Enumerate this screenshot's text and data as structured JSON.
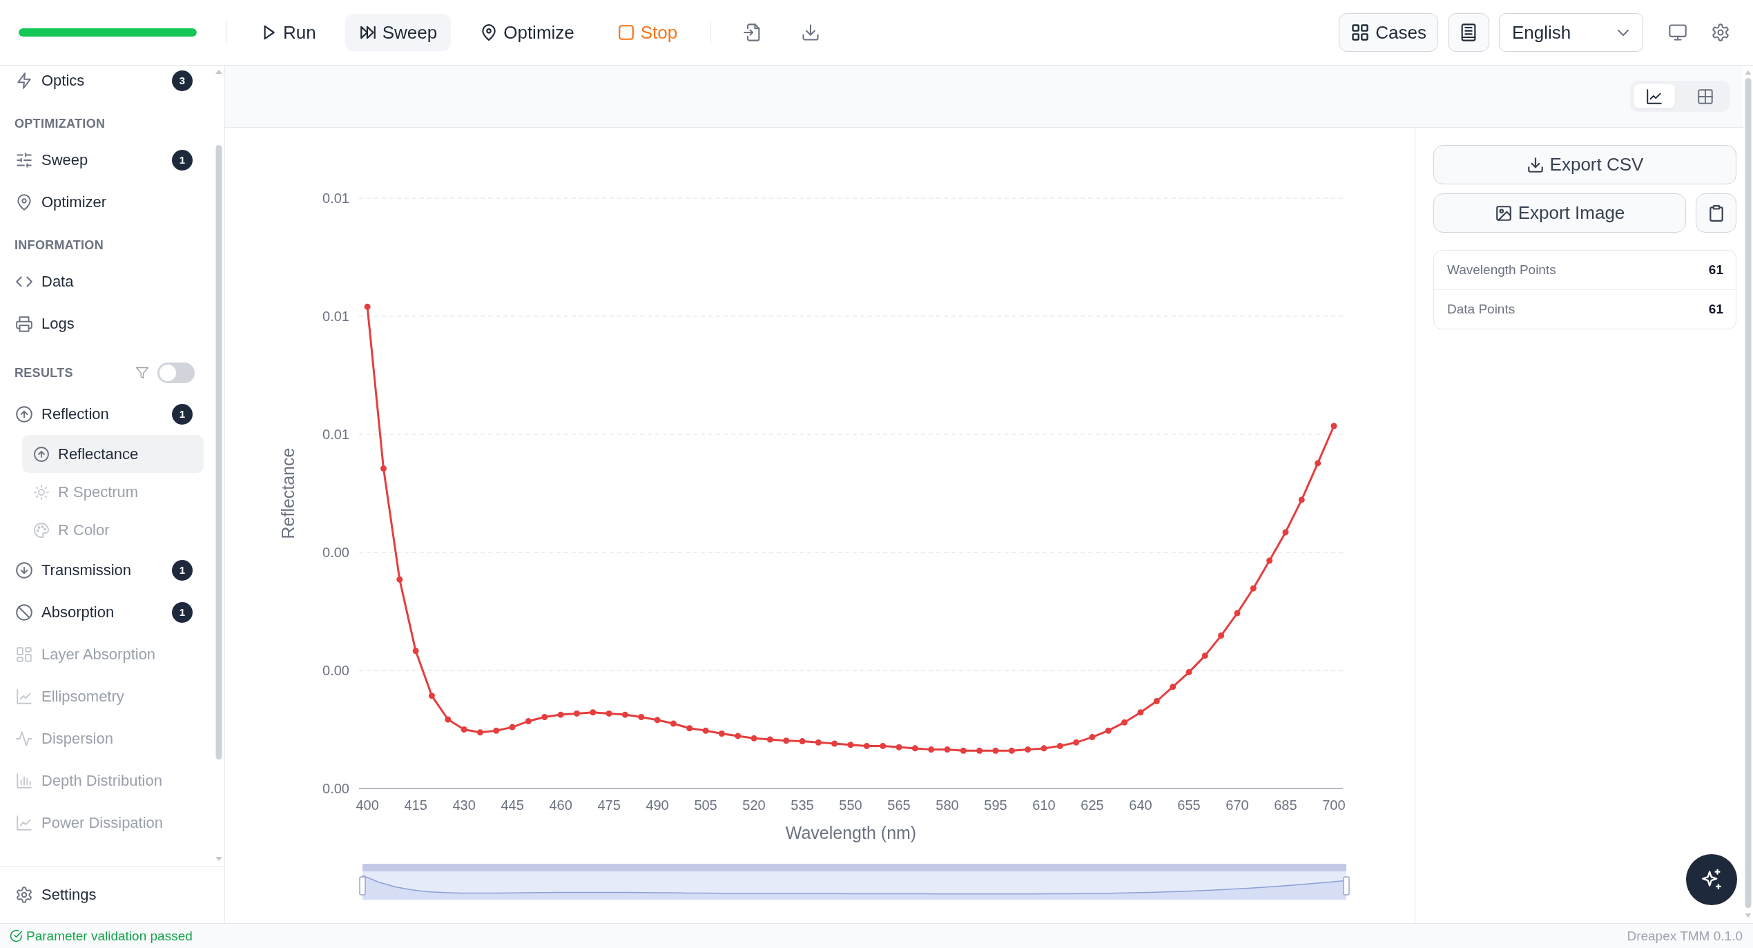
{
  "toolbar": {
    "progress": {
      "level": 1
    },
    "actions": [
      {
        "kind": "run",
        "label": "Run",
        "selected": false
      },
      {
        "kind": "sweep",
        "label": "Sweep",
        "selected": true
      },
      {
        "kind": "optimize",
        "label": "Optimize",
        "selected": false
      },
      {
        "kind": "stop",
        "label": "Stop",
        "selected": false
      }
    ],
    "cases_button": "Cases",
    "language": "English"
  },
  "sidebar": {
    "sections": [
      {
        "items": [
          {
            "kind": "optics",
            "label": "Optics",
            "badge": "3",
            "selected": false,
            "disabled": false
          }
        ]
      },
      {
        "heading": "OPTIMIZATION",
        "items": [
          {
            "kind": "sweep",
            "label": "Sweep",
            "badge": "1",
            "selected": false,
            "disabled": false
          },
          {
            "kind": "optimizer",
            "label": "Optimizer",
            "selected": false,
            "disabled": false
          }
        ]
      },
      {
        "heading": "INFORMATION",
        "items": [
          {
            "kind": "data",
            "label": "Data",
            "selected": false,
            "disabled": false
          },
          {
            "kind": "logs",
            "label": "Logs",
            "selected": false,
            "disabled": false
          }
        ]
      },
      {
        "heading": "RESULTS",
        "filter_toggle": {
          "on": false
        },
        "items": [
          {
            "kind": "reflection",
            "label": "Reflection",
            "badge": "1",
            "selected": false,
            "disabled": false,
            "children": [
              {
                "kind": "reflectance",
                "label": "Reflectance",
                "selected": true,
                "disabled": false
              },
              {
                "kind": "spectrum",
                "label": "R Spectrum",
                "selected": false,
                "disabled": true
              },
              {
                "kind": "color",
                "label": "R Color",
                "selected": false,
                "disabled": true
              }
            ]
          },
          {
            "kind": "transmission",
            "label": "Transmission",
            "badge": "1",
            "selected": false,
            "disabled": false
          },
          {
            "kind": "absorption",
            "label": "Absorption",
            "badge": "1",
            "selected": false,
            "disabled": false
          },
          {
            "kind": "layers",
            "label": "Layer Absorption",
            "selected": false,
            "disabled": true
          },
          {
            "kind": "ellipsometry",
            "label": "Ellipsometry",
            "selected": false,
            "disabled": true
          },
          {
            "kind": "dispersion",
            "label": "Dispersion",
            "selected": false,
            "disabled": true
          },
          {
            "kind": "depth",
            "label": "Depth Distribution",
            "selected": false,
            "disabled": true
          },
          {
            "kind": "power",
            "label": "Power Dissipation",
            "selected": false,
            "disabled": true
          }
        ]
      }
    ],
    "footer_item": "Settings"
  },
  "view_toggle": [
    {
      "kind": "chart",
      "selected": true
    },
    {
      "kind": "table",
      "selected": false
    }
  ],
  "chart_panel": {
    "chart_data": {
      "type": "line",
      "xlabel": "Wavelength (nm)",
      "ylabel": "Reflectance",
      "x": [
        400,
        405,
        410,
        415,
        420,
        425,
        430,
        435,
        440,
        445,
        450,
        455,
        460,
        465,
        470,
        475,
        480,
        485,
        490,
        495,
        500,
        505,
        510,
        515,
        520,
        525,
        530,
        535,
        540,
        545,
        550,
        555,
        560,
        565,
        570,
        575,
        580,
        585,
        590,
        595,
        600,
        605,
        610,
        615,
        620,
        625,
        630,
        635,
        640,
        645,
        650,
        655,
        660,
        665,
        670,
        675,
        680,
        685,
        690,
        695,
        700
      ],
      "series": [
        {
          "color": "#e53e3e",
          "marker": "circle",
          "values": [
            0.00816,
            0.00542,
            0.00354,
            0.00233,
            0.00157,
            0.00117,
            0.001,
            0.00095,
            0.00098,
            0.00104,
            0.00114,
            0.00121,
            0.00125,
            0.00127,
            0.00129,
            0.00127,
            0.00125,
            0.00121,
            0.00116,
            0.0011,
            0.00102,
            0.00098,
            0.00093,
            0.00089,
            0.00085,
            0.00083,
            0.00081,
            0.0008,
            0.00078,
            0.00076,
            0.00074,
            0.00072,
            0.00072,
            0.0007,
            0.00068,
            0.00066,
            0.00066,
            0.00064,
            0.00064,
            0.00064,
            0.00064,
            0.00066,
            0.00068,
            0.00072,
            0.00078,
            0.00087,
            0.00098,
            0.00112,
            0.00129,
            0.00148,
            0.00172,
            0.00197,
            0.00225,
            0.00259,
            0.00297,
            0.00339,
            0.00386,
            0.00434,
            0.00489,
            0.00551,
            0.00614
          ]
        }
      ],
      "xlim": [
        397.4,
        702.8
      ],
      "ylim": [
        0,
        0.01
      ],
      "xticks": [
        400,
        415,
        430,
        445,
        460,
        475,
        490,
        505,
        520,
        535,
        550,
        565,
        580,
        595,
        610,
        625,
        640,
        655,
        670,
        685,
        700
      ],
      "yticks": [
        {
          "value": 0,
          "label": "0.00"
        },
        {
          "value": 0.002,
          "label": "0.00"
        },
        {
          "value": 0.004,
          "label": "0.00"
        },
        {
          "value": 0.006,
          "label": "0.01"
        },
        {
          "value": 0.008,
          "label": "0.01"
        },
        {
          "value": 0.01,
          "label": "0.01"
        }
      ],
      "grid": true
    },
    "data_zoom": {
      "level": 1
    }
  },
  "side_panel": {
    "export_buttons": [
      "Export CSV",
      "Export Image"
    ],
    "stats": [
      {
        "label": "Wavelength Points",
        "value": "61"
      },
      {
        "label": "Data Points",
        "value": "61"
      }
    ]
  },
  "status_bar": {
    "message": "Parameter validation passed",
    "version": "Dreapex TMM 0.1.0"
  }
}
